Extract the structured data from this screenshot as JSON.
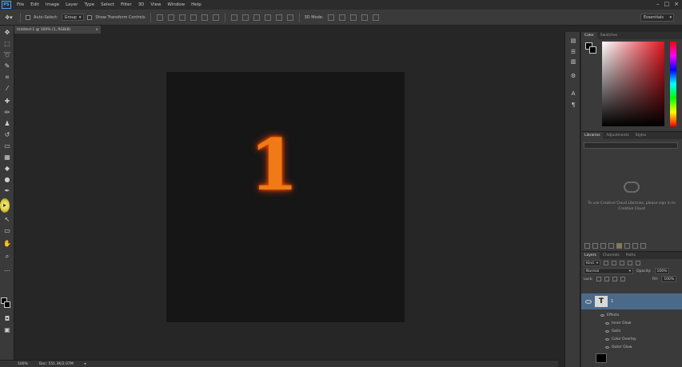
{
  "menubar": {
    "logo": "PS",
    "items": [
      "File",
      "Edit",
      "Image",
      "Layer",
      "Type",
      "Select",
      "Filter",
      "3D",
      "View",
      "Window",
      "Help"
    ],
    "window_controls": [
      "–",
      "□",
      "×"
    ]
  },
  "options": {
    "tool_icon": "move-tool-icon",
    "auto_select_label": "Auto-Select:",
    "auto_select_value": "Group",
    "transform_label": "Show Transform Controls",
    "mode_label": "3D Mode:",
    "workspace": "Essentials"
  },
  "document": {
    "tab_label": "Untitled-1 @ 100% (1, RGB/8)",
    "glyph": "1",
    "glyph_color": "#f07a16",
    "status_zoom": "100%",
    "status_doc": "Doc: 551.3K/2.07M"
  },
  "color_panel": {
    "tabs": [
      "Color",
      "Swatches"
    ]
  },
  "libraries_panel": {
    "tabs": [
      "Libraries",
      "Adjustments",
      "Styles"
    ],
    "message": "To use Creative Cloud Libraries, please sign in to Creative Cloud"
  },
  "layers_panel": {
    "tabs": [
      "Layers",
      "Channels",
      "Paths"
    ],
    "kind_label": "Kind",
    "blend_mode": "Normal",
    "opacity_label": "Opacity:",
    "opacity_value": "100%",
    "lock_label": "Lock:",
    "fill_label": "Fill:",
    "fill_value": "100%",
    "layer_name": "1",
    "effects_label": "Effects",
    "effects": [
      "Inner Glow",
      "Satin",
      "Color Overlay",
      "Outer Glow"
    ]
  }
}
